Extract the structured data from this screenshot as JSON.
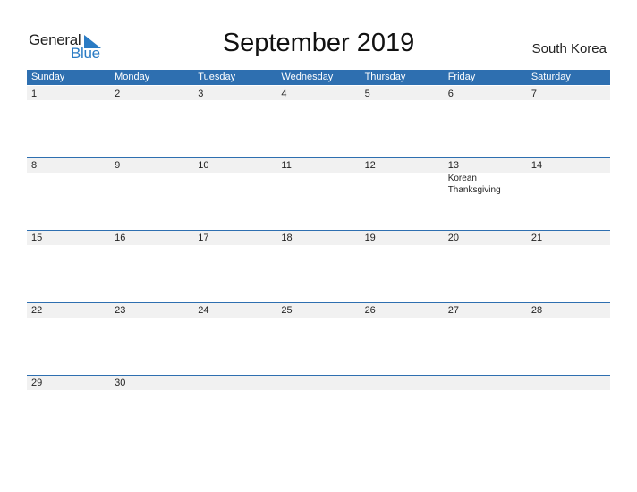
{
  "logo": {
    "general": "General",
    "blue": "Blue",
    "accent": "#2a7bc4"
  },
  "title": "September 2019",
  "country": "South Korea",
  "colors": {
    "header_bg": "#2e6fb0",
    "strip_bg": "#f1f1f1"
  },
  "weekdays": [
    "Sunday",
    "Monday",
    "Tuesday",
    "Wednesday",
    "Thursday",
    "Friday",
    "Saturday"
  ],
  "weeks": [
    {
      "days": [
        {
          "num": "1"
        },
        {
          "num": "2"
        },
        {
          "num": "3"
        },
        {
          "num": "4"
        },
        {
          "num": "5"
        },
        {
          "num": "6"
        },
        {
          "num": "7"
        }
      ]
    },
    {
      "days": [
        {
          "num": "8"
        },
        {
          "num": "9"
        },
        {
          "num": "10"
        },
        {
          "num": "11"
        },
        {
          "num": "12"
        },
        {
          "num": "13",
          "event": "Korean Thanksgiving"
        },
        {
          "num": "14"
        }
      ]
    },
    {
      "days": [
        {
          "num": "15"
        },
        {
          "num": "16"
        },
        {
          "num": "17"
        },
        {
          "num": "18"
        },
        {
          "num": "19"
        },
        {
          "num": "20"
        },
        {
          "num": "21"
        }
      ]
    },
    {
      "days": [
        {
          "num": "22"
        },
        {
          "num": "23"
        },
        {
          "num": "24"
        },
        {
          "num": "25"
        },
        {
          "num": "26"
        },
        {
          "num": "27"
        },
        {
          "num": "28"
        }
      ]
    },
    {
      "days": [
        {
          "num": "29"
        },
        {
          "num": "30"
        },
        {
          "num": ""
        },
        {
          "num": ""
        },
        {
          "num": ""
        },
        {
          "num": ""
        },
        {
          "num": ""
        }
      ]
    }
  ]
}
